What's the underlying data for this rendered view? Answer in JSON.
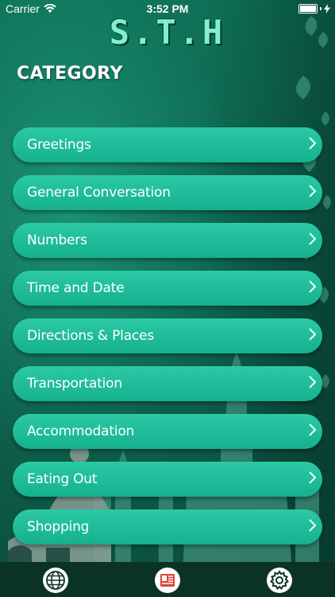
{
  "status_bar": {
    "carrier": "Carrier",
    "time": "3:52 PM"
  },
  "app": {
    "title": "S.T.H"
  },
  "section": {
    "title": "CATEGORY"
  },
  "categories": [
    {
      "label": "Greetings"
    },
    {
      "label": "General Conversation"
    },
    {
      "label": "Numbers"
    },
    {
      "label": "Time and Date"
    },
    {
      "label": "Directions & Places"
    },
    {
      "label": "Transportation"
    },
    {
      "label": "Accommodation"
    },
    {
      "label": "Eating Out"
    },
    {
      "label": "Shopping"
    }
  ],
  "tabbar": {
    "tabs": [
      {
        "icon": "globe-icon"
      },
      {
        "icon": "phrasebook-icon",
        "active": true
      },
      {
        "icon": "gear-icon"
      }
    ]
  },
  "colors": {
    "background": "#0d5f4a",
    "item": "#1fbd98",
    "title": "#7ff0c8",
    "tabbar": "#0a3326",
    "active_tab": "#e0453a"
  }
}
